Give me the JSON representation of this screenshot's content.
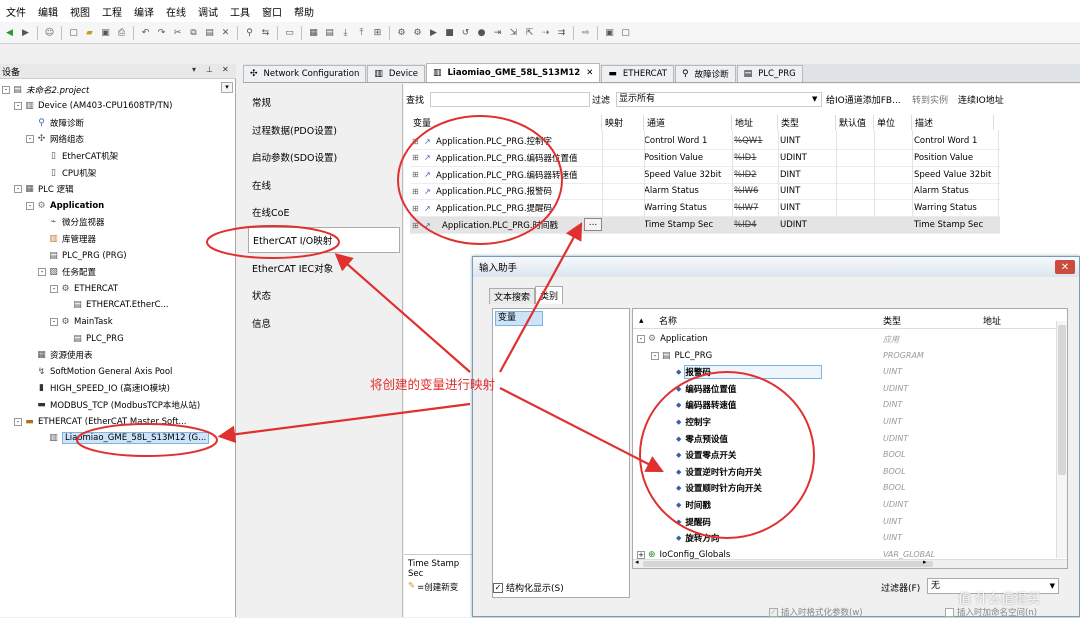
{
  "menu": [
    "文件",
    "编辑",
    "视图",
    "工程",
    "编译",
    "在线",
    "调试",
    "工具",
    "窗口",
    "帮助"
  ],
  "devices_panel": {
    "title": "设备",
    "tree": [
      {
        "level": 0,
        "label": "未命名2.project",
        "icon": "project-icon",
        "exp": "-"
      },
      {
        "level": 1,
        "label": "Device (AM403-CPU1608TP/TN)",
        "icon": "device-icon",
        "exp": "-"
      },
      {
        "level": 2,
        "label": "故障诊断",
        "icon": "diagnosis-icon",
        "exp": ""
      },
      {
        "level": 2,
        "label": "网络组态",
        "icon": "network-icon",
        "exp": "-"
      },
      {
        "level": 3,
        "label": "EtherCAT机架",
        "icon": "rack-icon",
        "exp": ""
      },
      {
        "level": 3,
        "label": "CPU机架",
        "icon": "rack-icon",
        "exp": ""
      },
      {
        "level": 1,
        "label": "PLC 逻辑",
        "icon": "plc-logic-icon",
        "exp": "-"
      },
      {
        "level": 2,
        "label": "Application",
        "icon": "application-icon",
        "exp": "-",
        "bold": true
      },
      {
        "level": 3,
        "label": "微分监视器",
        "icon": "monitor-icon",
        "exp": ""
      },
      {
        "level": 3,
        "label": "库管理器",
        "icon": "library-icon",
        "exp": ""
      },
      {
        "level": 3,
        "label": "PLC_PRG (PRG)",
        "icon": "program-icon",
        "exp": ""
      },
      {
        "level": 3,
        "label": "任务配置",
        "icon": "task-config-icon",
        "exp": "-"
      },
      {
        "level": 4,
        "label": "ETHERCAT",
        "icon": "task-icon",
        "exp": "-"
      },
      {
        "level": 5,
        "label": "ETHERCAT.EtherC...",
        "icon": "program-icon",
        "exp": ""
      },
      {
        "level": 4,
        "label": "MainTask",
        "icon": "task-icon",
        "exp": "-"
      },
      {
        "level": 5,
        "label": "PLC_PRG",
        "icon": "program-icon",
        "exp": ""
      },
      {
        "level": 2,
        "label": "资源使用表",
        "icon": "table-icon",
        "exp": ""
      },
      {
        "level": 2,
        "label": "SoftMotion General Axis Pool",
        "icon": "axis-icon",
        "exp": ""
      },
      {
        "level": 2,
        "label": "HIGH_SPEED_IO (高速IO模块)",
        "icon": "io-icon",
        "exp": ""
      },
      {
        "level": 2,
        "label": "MODBUS_TCP (ModbusTCP本地从站)",
        "icon": "modbus-icon",
        "exp": ""
      },
      {
        "level": 1,
        "label": "ETHERCAT (EtherCAT Master Soft...",
        "icon": "ethercat-icon",
        "exp": "-"
      },
      {
        "level": 3,
        "label": "Liaomiao_GME_58L_S13M12 (G...",
        "icon": "slave-icon",
        "exp": "",
        "selected": true
      }
    ]
  },
  "tabs": [
    {
      "label": "Network Configuration",
      "icon": "network-config-icon",
      "active": false,
      "close": false
    },
    {
      "label": "Device",
      "icon": "device-icon",
      "active": false,
      "close": false
    },
    {
      "label": "Liaomiao_GME_58L_S13M12",
      "icon": "slave-icon",
      "active": true,
      "close": true
    },
    {
      "label": "ETHERCAT",
      "icon": "ethercat-icon",
      "active": false,
      "close": false
    },
    {
      "label": "故障诊断",
      "icon": "diagnosis-icon",
      "active": false,
      "close": false
    },
    {
      "label": "PLC_PRG",
      "icon": "program-icon",
      "active": false,
      "close": false
    }
  ],
  "left_nav": [
    "常规",
    "过程数据(PDO设置)",
    "启动参数(SDO设置)",
    "在线",
    "在线CoE",
    "EtherCAT I/O映射",
    "EtherCAT IEC对象",
    "状态",
    "信息"
  ],
  "left_nav_selected": 5,
  "filter": {
    "search_label": "查找",
    "filter_label": "过滤",
    "filter_value": "显示所有",
    "add_fb": "给IO通道添加FB...",
    "goto": "转到实例",
    "continuous": "连续IO地址"
  },
  "grid_headers": [
    "变量",
    "映射",
    "通道",
    "地址",
    "类型",
    "默认值",
    "单位",
    "描述"
  ],
  "grid_rows": [
    {
      "var": "Application.PLC_PRG.控制字",
      "channel": "Control Word 1",
      "addr": "%QW1",
      "type": "UINT",
      "desc": "Control Word 1"
    },
    {
      "var": "Application.PLC_PRG.编码器位置值",
      "channel": "Position Value",
      "addr": "%ID1",
      "type": "UDINT",
      "desc": "Position Value"
    },
    {
      "var": "Application.PLC_PRG.编码器转速值",
      "channel": "Speed Value 32bit",
      "addr": "%ID2",
      "type": "DINT",
      "desc": "Speed Value 32bit"
    },
    {
      "var": "Application.PLC_PRG.报警码",
      "channel": "Alarm Status",
      "addr": "%IW6",
      "type": "UINT",
      "desc": "Alarm Status"
    },
    {
      "var": "Application.PLC_PRG.提醒码",
      "channel": "Warring Status",
      "addr": "%IW7",
      "type": "UINT",
      "desc": "Warring Status"
    },
    {
      "var": "Application.PLC_PRG.时间戳",
      "channel": "Time Stamp Sec",
      "addr": "%ID4",
      "type": "UDINT",
      "desc": "Time Stamp Sec",
      "editing": true
    }
  ],
  "bottom_info": {
    "line1": "Time Stamp Sec",
    "line2": "=创建新变"
  },
  "dialog": {
    "title": "输入助手",
    "tabs": [
      "文本搜索",
      "类别"
    ],
    "category": "变量",
    "headers": [
      "名称",
      "类型",
      "地址"
    ],
    "items": [
      {
        "indent": 0,
        "exp": "-",
        "icon": "application-icon",
        "label": "Application",
        "type": "应用",
        "bold": false
      },
      {
        "indent": 1,
        "exp": "-",
        "icon": "program-icon",
        "label": "PLC_PRG",
        "type": "PROGRAM",
        "bold": false
      },
      {
        "indent": 2,
        "exp": "",
        "icon": "variable-icon",
        "label": "报警码",
        "type": "UINT",
        "bold": true,
        "selected": true
      },
      {
        "indent": 2,
        "exp": "",
        "icon": "variable-icon",
        "label": "编码器位置值",
        "type": "UDINT",
        "bold": true
      },
      {
        "indent": 2,
        "exp": "",
        "icon": "variable-icon",
        "label": "编码器转速值",
        "type": "DINT",
        "bold": true
      },
      {
        "indent": 2,
        "exp": "",
        "icon": "variable-icon",
        "label": "控制字",
        "type": "UINT",
        "bold": true
      },
      {
        "indent": 2,
        "exp": "",
        "icon": "variable-icon",
        "label": "零点预设值",
        "type": "UDINT",
        "bold": true
      },
      {
        "indent": 2,
        "exp": "",
        "icon": "variable-icon",
        "label": "设置零点开关",
        "type": "BOOL",
        "bold": true
      },
      {
        "indent": 2,
        "exp": "",
        "icon": "variable-icon",
        "label": "设置逆时针方向开关",
        "type": "BOOL",
        "bold": true
      },
      {
        "indent": 2,
        "exp": "",
        "icon": "variable-icon",
        "label": "设置顺时针方向开关",
        "type": "BOOL",
        "bold": true
      },
      {
        "indent": 2,
        "exp": "",
        "icon": "variable-icon",
        "label": "时间戳",
        "type": "UDINT",
        "bold": true
      },
      {
        "indent": 2,
        "exp": "",
        "icon": "variable-icon",
        "label": "提醒码",
        "type": "UINT",
        "bold": true
      },
      {
        "indent": 2,
        "exp": "",
        "icon": "variable-icon",
        "label": "旋转方向",
        "type": "UINT",
        "bold": true
      },
      {
        "indent": 0,
        "exp": "+",
        "icon": "globals-icon",
        "label": "IoConfig_Globals",
        "type": "VAR_GLOBAL",
        "bold": false
      }
    ],
    "structured": "结构化显示(S)",
    "filter_label": "过滤器(F)",
    "filter_value": "无",
    "opt1": "插入时格式化参数(w)",
    "opt2": "插入时加命名空间(n)"
  },
  "annotation": "将创建的变量进行映射",
  "watermark": "值 什么值得买",
  "colors": {
    "annotation": "#e03030",
    "selection": "#cde3f7"
  }
}
